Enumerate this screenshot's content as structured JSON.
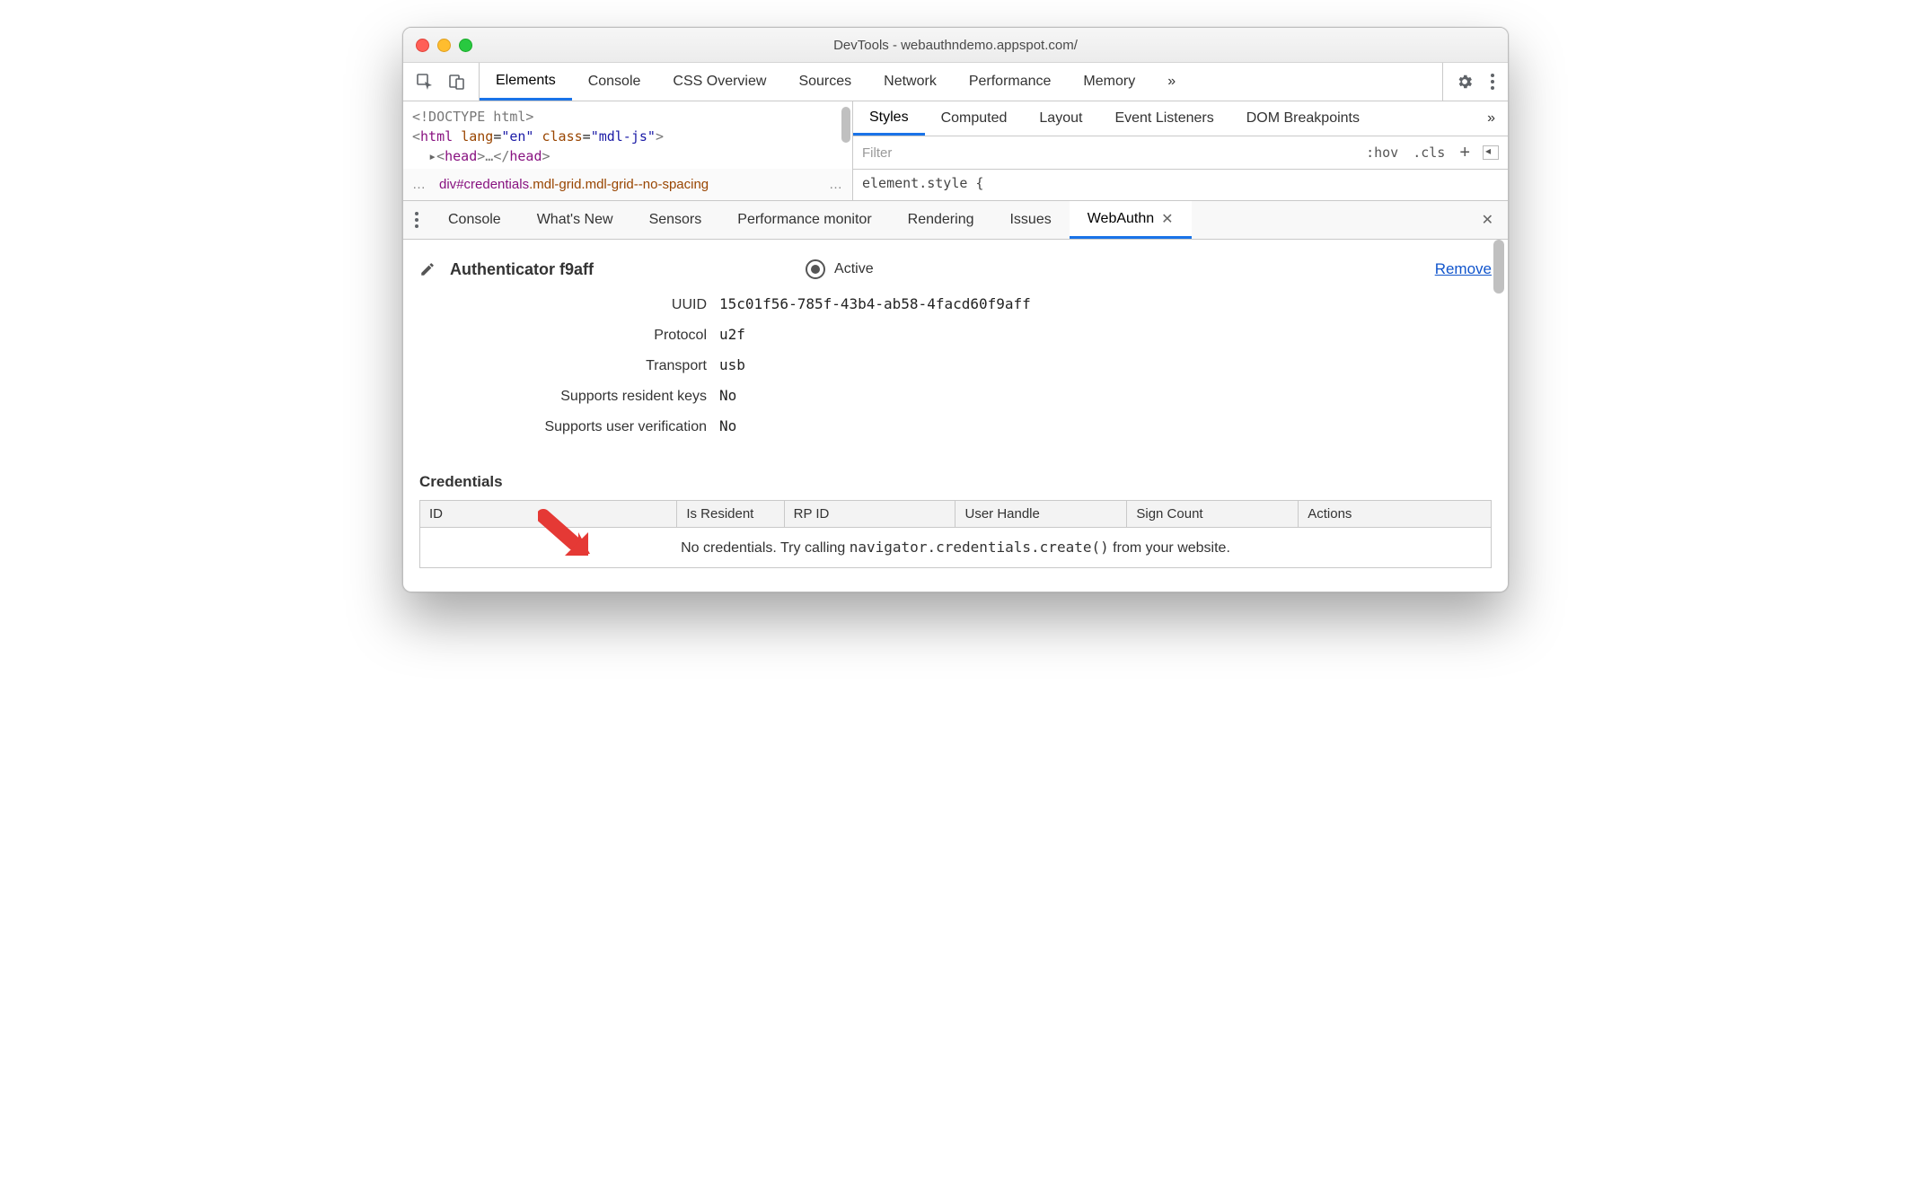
{
  "window": {
    "title": "DevTools - webauthndemo.appspot.com/"
  },
  "toolbar": {
    "tabs": [
      "Elements",
      "Console",
      "CSS Overview",
      "Sources",
      "Network",
      "Performance",
      "Memory"
    ],
    "active": 0,
    "overflow": "»"
  },
  "dom": {
    "line1_pre": "<!DOCTYPE html>",
    "line2_open": "<",
    "line2_tag": "html",
    "line2_sp": " ",
    "line2_a1n": "lang",
    "line2_a1v": "\"en\"",
    "line2_a2n": "class",
    "line2_a2v": "\"mdl-js\"",
    "line2_close": ">",
    "line3_tri": "▸",
    "line3_open": "<",
    "line3_tag": "head",
    "line3_close": ">",
    "line3_dots": "…",
    "line3_end_open": "</",
    "line3_end_tag": "head",
    "line3_end_close": ">"
  },
  "breadcrumb": {
    "dots": "…",
    "tag": "div",
    "id": "#credentials",
    "cls": ".mdl-grid.mdl-grid--no-spacing",
    "tail": "…"
  },
  "styles": {
    "tabs": [
      "Styles",
      "Computed",
      "Layout",
      "Event Listeners",
      "DOM Breakpoints"
    ],
    "active": 0,
    "overflow": "»",
    "filter_placeholder": "Filter",
    "hov": ":hov",
    "cls": ".cls",
    "plus": "+",
    "element_style": "element.style {"
  },
  "drawer": {
    "tabs": [
      "Console",
      "What's New",
      "Sensors",
      "Performance monitor",
      "Rendering",
      "Issues",
      "WebAuthn"
    ],
    "active": 6
  },
  "auth": {
    "name": "Authenticator f9aff",
    "active_label": "Active",
    "remove": "Remove",
    "props": [
      {
        "label": "UUID",
        "value": "15c01f56-785f-43b4-ab58-4facd60f9aff"
      },
      {
        "label": "Protocol",
        "value": "u2f"
      },
      {
        "label": "Transport",
        "value": "usb"
      },
      {
        "label": "Supports resident keys",
        "value": "No"
      },
      {
        "label": "Supports user verification",
        "value": "No"
      }
    ]
  },
  "credentials": {
    "title": "Credentials",
    "headers": [
      "ID",
      "Is Resident",
      "RP ID",
      "User Handle",
      "Sign Count",
      "Actions"
    ],
    "empty_pre": "No credentials. Try calling ",
    "empty_code": "navigator.credentials.create()",
    "empty_post": " from your website."
  }
}
